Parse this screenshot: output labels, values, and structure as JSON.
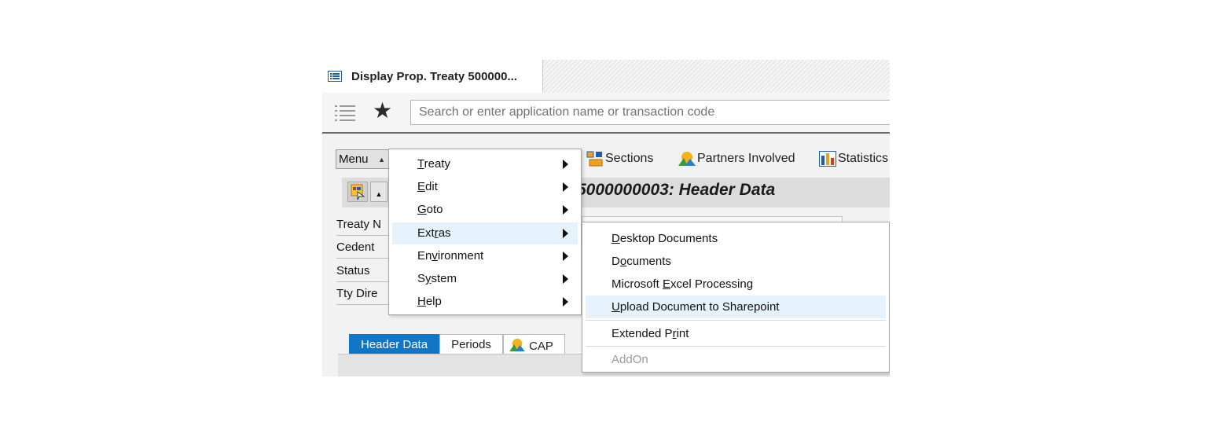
{
  "window": {
    "tab_title": "Display Prop. Treaty 500000..."
  },
  "shell": {
    "search_placeholder": "Search or enter application name or transaction code"
  },
  "toolbar": {
    "menu_label": "Menu",
    "items": [
      {
        "label": "Sections",
        "icon": "sections-icon"
      },
      {
        "label": "Partners Involved",
        "icon": "partners-icon"
      },
      {
        "label": "Statistics",
        "icon": "statistics-icon"
      }
    ]
  },
  "page": {
    "title": "r 5000000003: Header Data"
  },
  "fields": [
    {
      "label": "Treaty N"
    },
    {
      "label": "Cedent"
    },
    {
      "label": "Status"
    },
    {
      "label": "Tty Dire"
    }
  ],
  "tabs": [
    {
      "label": "Header Data",
      "active": true
    },
    {
      "label": "Periods",
      "active": false
    },
    {
      "label": "CAP",
      "active": false
    }
  ],
  "main_menu": {
    "items": [
      {
        "pre": "",
        "key": "T",
        "post": "reaty"
      },
      {
        "pre": "",
        "key": "E",
        "post": "dit"
      },
      {
        "pre": "",
        "key": "G",
        "post": "oto"
      },
      {
        "pre": "Ext",
        "key": "r",
        "post": "as"
      },
      {
        "pre": "En",
        "key": "v",
        "post": "ironment"
      },
      {
        "pre": "S",
        "key": "y",
        "post": "stem"
      },
      {
        "pre": "",
        "key": "H",
        "post": "elp"
      }
    ],
    "highlighted_index": 3
  },
  "submenu_extras": {
    "items": [
      {
        "pre": "",
        "key": "D",
        "post": "esktop Documents",
        "state": "normal"
      },
      {
        "pre": "D",
        "key": "o",
        "post": "cuments",
        "state": "normal"
      },
      {
        "pre": "Microsoft ",
        "key": "E",
        "post": "xcel Processing",
        "state": "normal"
      },
      {
        "pre": "",
        "key": "U",
        "post": "pload Document to Sharepoint",
        "state": "highlighted"
      },
      {
        "pre": "Extended P",
        "key": "r",
        "post": "int",
        "state": "normal"
      },
      {
        "pre": "AddOn",
        "key": "",
        "post": "",
        "state": "disabled"
      }
    ]
  },
  "colors": {
    "active_tab": "#1176c6",
    "menu_highlight": "#e5f1fb"
  }
}
